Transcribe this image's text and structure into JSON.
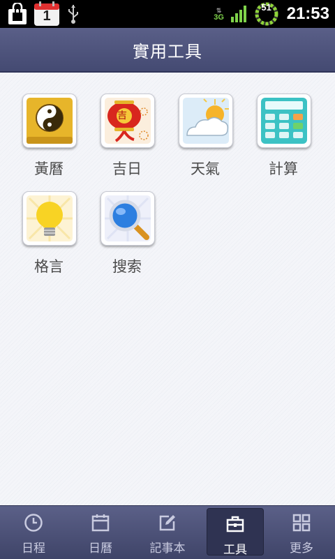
{
  "status_bar": {
    "calendar_day": "1",
    "network": "3G",
    "battery_level": "51",
    "time": "21:53"
  },
  "header": {
    "title": "實用工具"
  },
  "tools": [
    {
      "label": "黃曆",
      "icon": "yin-yang-icon"
    },
    {
      "label": "吉日",
      "icon": "lantern-icon",
      "glyph": "吉"
    },
    {
      "label": "天氣",
      "icon": "weather-icon"
    },
    {
      "label": "計算",
      "icon": "calculator-icon"
    },
    {
      "label": "格言",
      "icon": "lightbulb-icon"
    },
    {
      "label": "搜索",
      "icon": "magnifier-icon"
    }
  ],
  "tabs": [
    {
      "label": "日程",
      "icon": "clock-icon",
      "active": false
    },
    {
      "label": "日曆",
      "icon": "calendar-icon",
      "active": false
    },
    {
      "label": "記事本",
      "icon": "edit-icon",
      "active": false
    },
    {
      "label": "工具",
      "icon": "toolbox-icon",
      "active": true
    },
    {
      "label": "更多",
      "icon": "grid-icon",
      "active": false
    }
  ],
  "colors": {
    "header": "#4e5380",
    "tab_bar": "#4a4f78",
    "accent_green": "#7fd34a"
  }
}
